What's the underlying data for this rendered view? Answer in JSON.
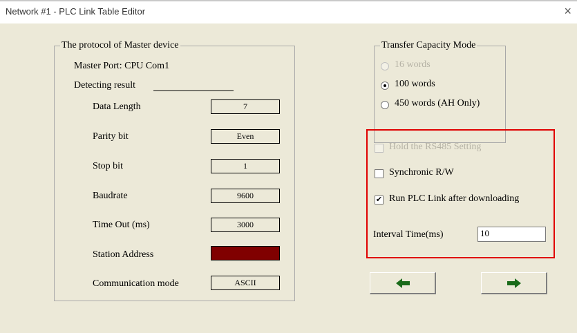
{
  "window": {
    "title": "Network #1 - PLC Link Table Editor",
    "close_glyph": "×"
  },
  "master": {
    "group_title": "The protocol of Master device",
    "master_port": "Master Port: CPU Com1",
    "detecting_result": "Detecting result",
    "rows": [
      {
        "label": "Data Length",
        "value": "7"
      },
      {
        "label": "Parity bit",
        "value": "Even"
      },
      {
        "label": "Stop bit",
        "value": "1"
      },
      {
        "label": "Baudrate",
        "value": "9600"
      },
      {
        "label": "Time Out (ms)",
        "value": "3000"
      },
      {
        "label": "Station Address",
        "value": ""
      },
      {
        "label": "Communication mode",
        "value": "ASCII"
      }
    ],
    "station_color": "#800000"
  },
  "transfer": {
    "group_title": "Transfer Capacity Mode",
    "options": [
      {
        "label": "16 words",
        "selected": false,
        "enabled": false
      },
      {
        "label": "100 words",
        "selected": true,
        "enabled": true
      },
      {
        "label": "450 words (AH Only)",
        "selected": false,
        "enabled": true
      }
    ]
  },
  "settings": {
    "hold_rs485": {
      "label": "Hold the RS485 Setting",
      "checked": false,
      "enabled": false
    },
    "synchronic": {
      "label": "Synchronic R/W",
      "checked": false,
      "enabled": true
    },
    "run_plc": {
      "label": "Run PLC Link after downloading",
      "checked": true,
      "enabled": true
    },
    "interval_label": "Interval Time(ms)",
    "interval_value": "10",
    "highlight_color": "#e00000"
  },
  "nav": {
    "prev_icon": "left-arrow-icon",
    "next_icon": "right-arrow-icon",
    "arrow_color": "#1a6b1a"
  }
}
